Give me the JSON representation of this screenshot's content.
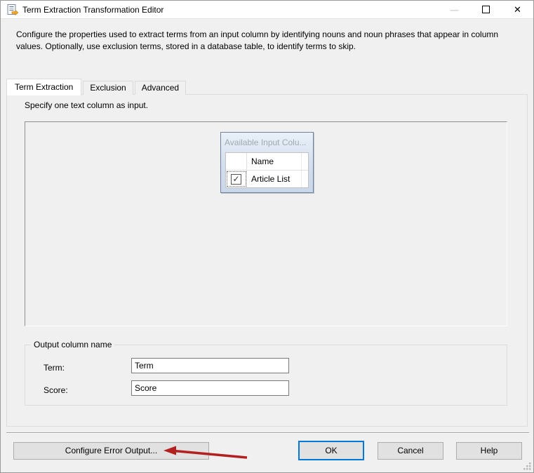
{
  "window": {
    "title": "Term Extraction Transformation Editor",
    "controls": {
      "minimize_glyph": "—",
      "close_glyph": "✕"
    }
  },
  "description": "Configure the properties used to extract terms from an input column by identifying nouns and noun phrases that appear in column values. Optionally, use exclusion terms, stored in a database table, to identify terms to skip.",
  "tabs": [
    {
      "label": "Term Extraction",
      "active": true
    },
    {
      "label": "Exclusion",
      "active": false
    },
    {
      "label": "Advanced",
      "active": false
    }
  ],
  "term_extraction_tab": {
    "instruction": "Specify one text column as input.",
    "available_columns_panel": {
      "title": "Available Input Colu...",
      "name_column_header": "Name",
      "rows": [
        {
          "checked": true,
          "check_glyph": "✓",
          "name": "Article List"
        }
      ]
    },
    "output_group": {
      "label": "Output column name",
      "term_label": "Term:",
      "term_value": "Term",
      "score_label": "Score:",
      "score_value": "Score"
    }
  },
  "footer": {
    "configure_error_output_label": "Configure Error Output...",
    "ok_label": "OK",
    "cancel_label": "Cancel",
    "help_label": "Help"
  },
  "icons": {
    "titlebar_icon": "document-with-arrow",
    "annotation_arrow": "red-arrow-pointing-left",
    "resize_grip": "grip-dots"
  },
  "colors": {
    "accent_default_button": "#0078d7",
    "annotation_arrow": "#b32020",
    "panel_border": "#73829b",
    "panel_header_text": "#a2a8b0",
    "dialog_bg": "#f0f0f0",
    "titlebar_bg": "#ffffff"
  }
}
